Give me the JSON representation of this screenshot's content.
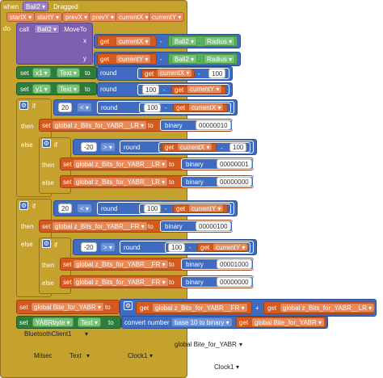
{
  "event": {
    "when": "when",
    "component": "Ball2",
    "event": "Dragged",
    "do": "do",
    "params": [
      "startX",
      "startY",
      "prevX",
      "prevY",
      "currentX",
      "currentY"
    ]
  },
  "call": {
    "call": "call",
    "component": "Ball2",
    "method": ".MoveTo",
    "x": "x",
    "y": "y"
  },
  "common": {
    "get": "get",
    "set": "set",
    "to": "to",
    "round": "round",
    "minus": "-",
    "plus": "+",
    "lt": "<",
    "gt": ">",
    "if": "if",
    "then": "then",
    "else": "else",
    "binary": "binary",
    "dot": ".",
    "radius": "Radius",
    "text": "Text",
    "ball2": "Ball2"
  },
  "vars": {
    "currentX": "currentX",
    "currentY": "currentY",
    "x1": "x1",
    "y1": "y1",
    "lr": "global z_Bits_for_YABR__LR",
    "fr": "global z_Bits_for_YABR__FR",
    "bite": "global Bite_for_YABR",
    "yabrbyte": "YABRbyte",
    "convert": "convert number",
    "b10": "base 10 to binary"
  },
  "nums": {
    "n100": "100",
    "n20": "20",
    "nm20": "-20",
    "b10": "00000010",
    "b01": "00000001",
    "b00": "00000000",
    "b0100": "00000100",
    "b1000": "00001000"
  },
  "bottom": {
    "bt": "BluetoothClient1",
    "bite": "global Bite_for_YABR",
    "milsec": "Milsec",
    "text": "Text",
    "clock": "Clock1"
  },
  "colors": {
    "event": "#c5a12e",
    "component": "#7d5fb0",
    "math": "#3f6cc0",
    "variable": "#d65a1e",
    "text": "#3d9b4a"
  }
}
